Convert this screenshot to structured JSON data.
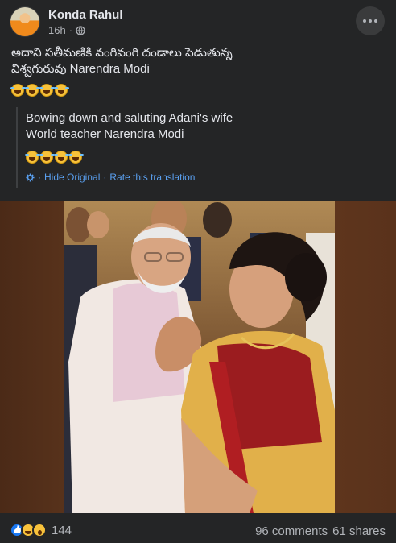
{
  "post": {
    "author": "Konda Rahul",
    "time": "16h",
    "time_separator": "·",
    "original_text_line1": "అదాని సతీమణికి వంగివంగి దండాలు పెడుతున్న",
    "original_text_line2": "విశ్వగురువు Narendra Modi",
    "translation_line1": "Bowing down and saluting Adani's wife",
    "translation_line2": "World teacher Narendra Modi",
    "hide_original_label": "Hide Original",
    "link_separator": "·",
    "rate_translation_label": "Rate this translation",
    "emoji_count": 4
  },
  "footer": {
    "reaction_count": "144",
    "comments": "96 comments",
    "shares": "61 shares"
  },
  "colors": {
    "background": "#242526",
    "text": "#e4e6eb",
    "secondary_text": "#b0b3b8",
    "link": "#2d88ff"
  },
  "icons": [
    "globe-icon",
    "more-options-icon",
    "gear-icon",
    "like-reaction-icon",
    "haha-reaction-icon",
    "wow-reaction-icon",
    "rofl-emoji-icon"
  ]
}
